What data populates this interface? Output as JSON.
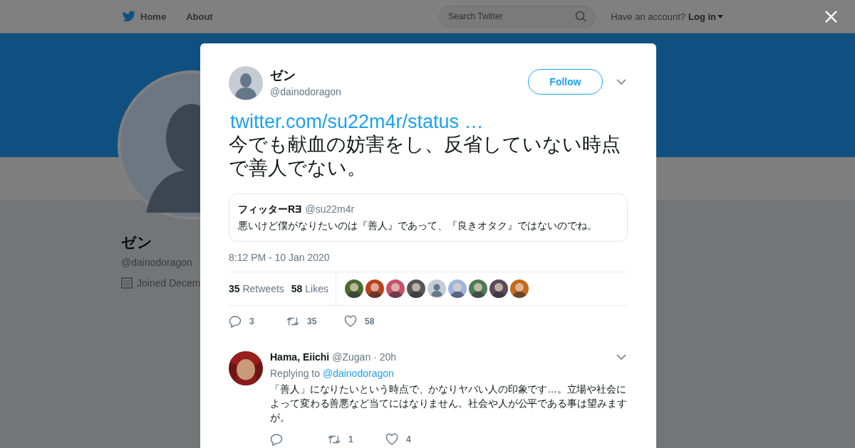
{
  "nav": {
    "items": [
      {
        "label": "Home",
        "kind": "home"
      },
      {
        "label": "About",
        "kind": "plain"
      }
    ],
    "search": {
      "placeholder": "Search Twitter"
    },
    "account_prompt": "Have an account?",
    "login": "Log in"
  },
  "profile": {
    "name": "ゼン",
    "handle": "@dainodoragon",
    "joined": "Joined Decem"
  },
  "tweet": {
    "name": "ゼン",
    "handle": "@dainodoragon",
    "follow": "Follow",
    "link": "twitter.com/su22m4r/status …",
    "text": "今でも献血の妨害をし、反省していない時点で善人でない。",
    "quote": {
      "name": "フィッターRƎ",
      "handle": "@su22m4r",
      "text": "悪いけど僕がなりたいのは『善人』であって、『良きオタク』ではないのでね。"
    },
    "timestamp": "8:12 PM - 10 Jan 2020",
    "stats": [
      {
        "count": "35",
        "label": "Retweets"
      },
      {
        "count": "58",
        "label": "Likes"
      }
    ],
    "likers": [
      {
        "kind": "picture"
      },
      {
        "kind": "picture"
      },
      {
        "kind": "picture"
      },
      {
        "kind": "picture"
      },
      {
        "kind": "default"
      },
      {
        "kind": "picture"
      },
      {
        "kind": "picture"
      },
      {
        "kind": "picture"
      },
      {
        "kind": "picture"
      }
    ],
    "actions": [
      {
        "kind": "reply",
        "count": "3"
      },
      {
        "kind": "retweet",
        "count": "35"
      },
      {
        "kind": "like",
        "count": "58"
      }
    ]
  },
  "reply": {
    "name": "Hama, Eiichi",
    "handle": "@Zugan",
    "time": "· 20h",
    "replying_prefix": "Replying to",
    "replying_to": "@dainodoragon",
    "text": "「善人」になりたいという時点で、かなりヤバい人の印象です…。立場や社会によって変わる善悪など当てにはなりません。社会や人が公平である事は望みますが。",
    "actions": [
      {
        "kind": "reply"
      },
      {
        "kind": "retweet",
        "count": "1"
      },
      {
        "kind": "like",
        "count": "4"
      }
    ]
  }
}
